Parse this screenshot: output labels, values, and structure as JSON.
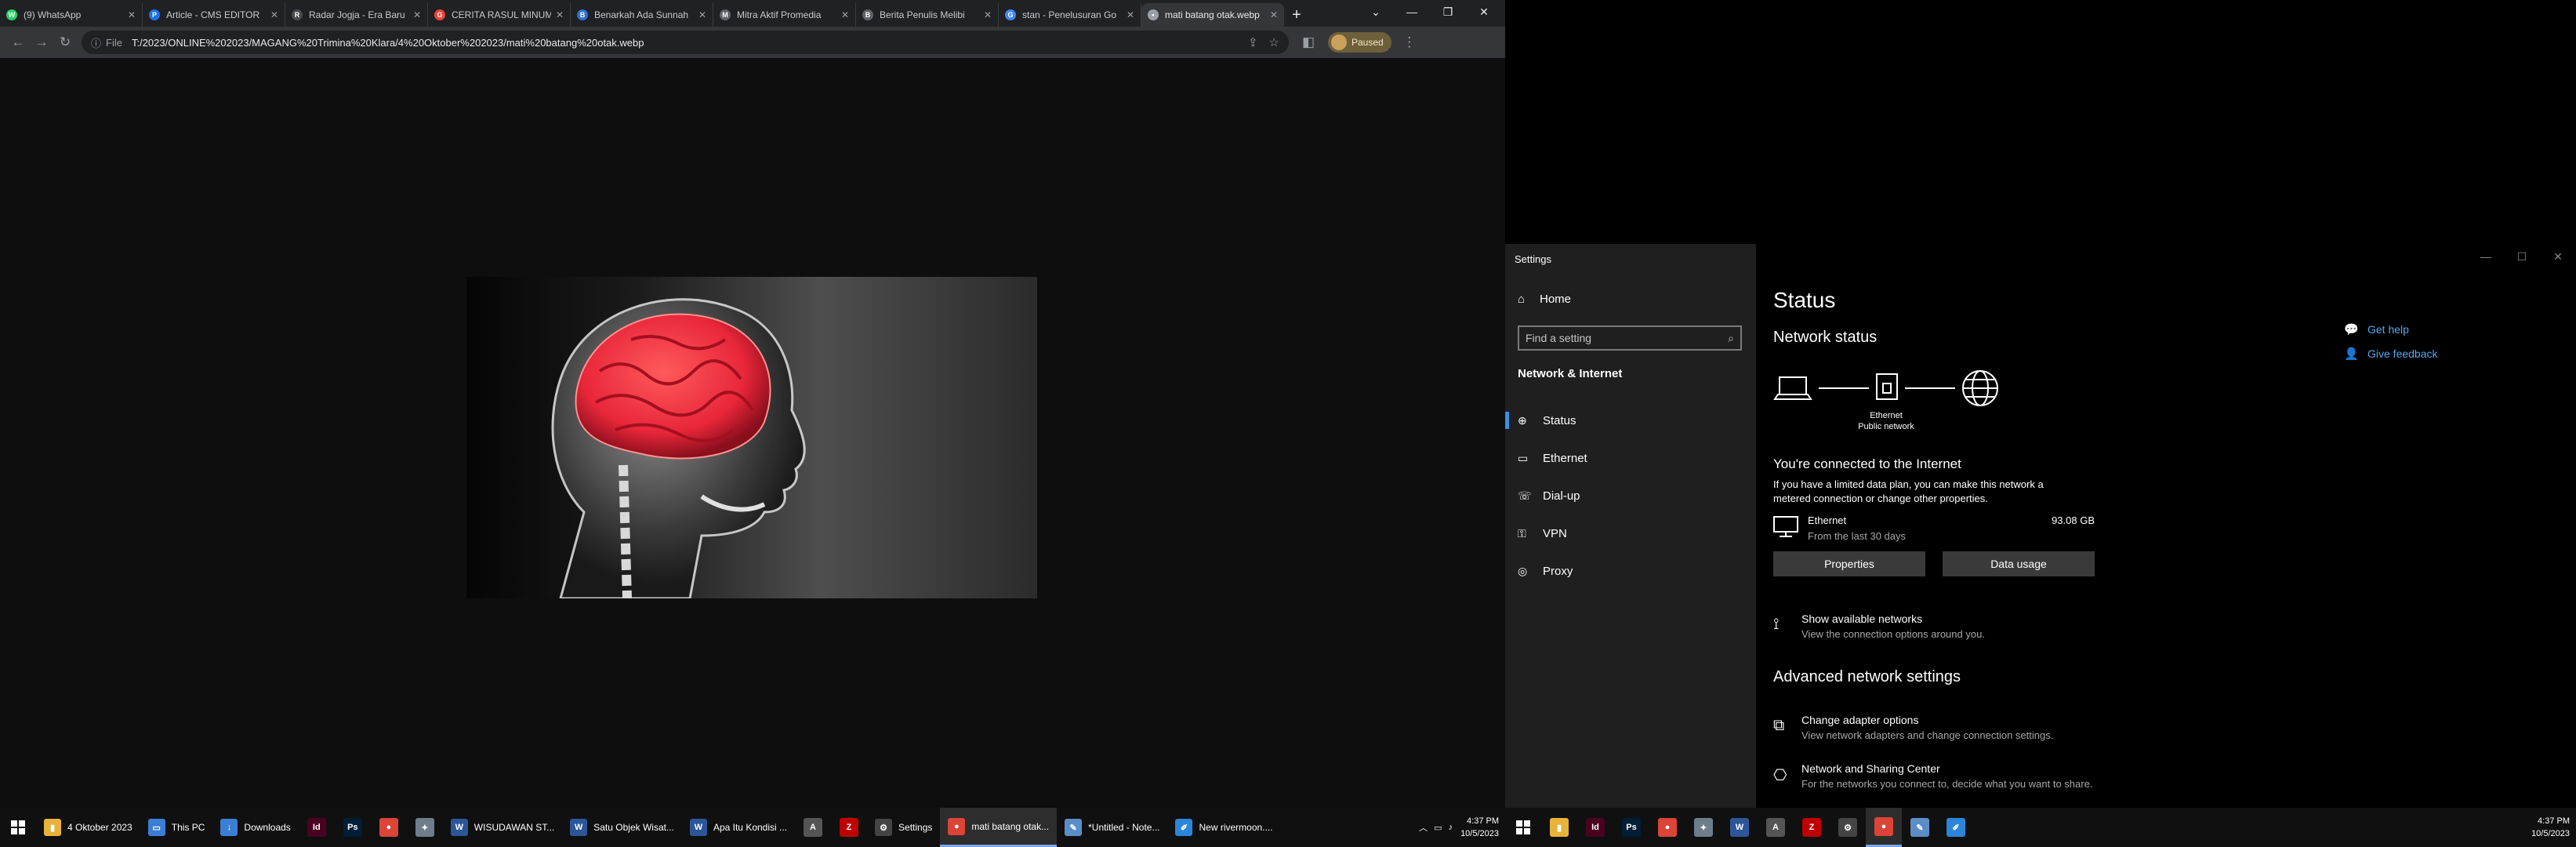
{
  "browser": {
    "tabs": [
      {
        "title": "(9) WhatsApp",
        "fav": "W",
        "color": "#25d366"
      },
      {
        "title": "Article - CMS EDITOR",
        "fav": "P",
        "color": "#1a73e8"
      },
      {
        "title": "Radar Jogja - Era Baru",
        "fav": "R",
        "color": "#4a4a4a"
      },
      {
        "title": "CERITA RASUL MINUM",
        "fav": "G",
        "color": "#ea4335"
      },
      {
        "title": "Benarkah Ada Sunnah",
        "fav": "B",
        "color": "#2f6fd6"
      },
      {
        "title": "Mitra Aktif Promedia",
        "fav": "M",
        "color": "#5f6368"
      },
      {
        "title": "Berita Penulis Melibi",
        "fav": "B",
        "color": "#5f6368"
      },
      {
        "title": "stan - Penelusuran Go",
        "fav": "G",
        "color": "#4285f4"
      },
      {
        "title": "mati batang otak.webp",
        "fav": "•",
        "color": "#9aa0a6"
      }
    ],
    "omnibox": {
      "scheme": "File",
      "url": "T:/2023/ONLINE%202023/MAGANG%20Trimina%20Klara/4%20Oktober%202023/mati%20batang%20otak.webp"
    },
    "profile_label": "Paused"
  },
  "taskbar_left": {
    "items": [
      {
        "label": "4 Oktober 2023",
        "icon": "folder-icon",
        "color": "#e8b33a",
        "glyph": "▮"
      },
      {
        "label": "This PC",
        "icon": "computer-icon",
        "color": "#3b7fd4",
        "glyph": "▭"
      },
      {
        "label": "Downloads",
        "icon": "downloads-icon",
        "color": "#3b7fd4",
        "glyph": "↓"
      },
      {
        "label": "",
        "icon": "indesign-icon",
        "color": "#49021f",
        "glyph": "Id"
      },
      {
        "label": "",
        "icon": "photoshop-icon",
        "color": "#001e36",
        "glyph": "Ps"
      },
      {
        "label": "",
        "icon": "chrome-icon",
        "color": "#db4437",
        "glyph": "●"
      },
      {
        "label": "",
        "icon": "tool-icon",
        "color": "#6d7d8b",
        "glyph": "✦"
      },
      {
        "label": "WISUDAWAN ST...",
        "icon": "word-icon",
        "color": "#2b579a",
        "glyph": "W"
      },
      {
        "label": "Satu Objek Wisat...",
        "icon": "word-icon",
        "color": "#2b579a",
        "glyph": "W"
      },
      {
        "label": "Apa Itu Kondisi ...",
        "icon": "word-icon",
        "color": "#2b579a",
        "glyph": "W"
      },
      {
        "label": "",
        "icon": "pdf-icon",
        "color": "#555555",
        "glyph": "A"
      },
      {
        "label": "",
        "icon": "filezilla-icon",
        "color": "#bf0000",
        "glyph": "Z"
      },
      {
        "label": "Settings",
        "icon": "gear-icon",
        "color": "#444444",
        "glyph": "⚙"
      },
      {
        "label": "mati batang otak...",
        "icon": "chrome-icon",
        "color": "#db4437",
        "glyph": "●",
        "active": true
      },
      {
        "label": "*Untitled - Note...",
        "icon": "notepad-icon",
        "color": "#5b8ec9",
        "glyph": "✎"
      },
      {
        "label": "New rivermoon....",
        "icon": "paint-icon",
        "color": "#2b86d9",
        "glyph": "✐"
      }
    ],
    "clock_time": "4:37 PM",
    "clock_date": "10/5/2023"
  },
  "taskbar_right": {
    "icons": [
      {
        "icon": "explorer-icon",
        "color": "#e8b33a",
        "glyph": "▮"
      },
      {
        "icon": "indesign-icon",
        "color": "#49021f",
        "glyph": "Id"
      },
      {
        "icon": "photoshop-icon",
        "color": "#001e36",
        "glyph": "Ps"
      },
      {
        "icon": "chrome-icon",
        "color": "#db4437",
        "glyph": "●"
      },
      {
        "icon": "tool-icon",
        "color": "#6d7d8b",
        "glyph": "✦"
      },
      {
        "icon": "word-icon",
        "color": "#2b579a",
        "glyph": "W"
      },
      {
        "icon": "pdf-icon",
        "color": "#555555",
        "glyph": "A"
      },
      {
        "icon": "filezilla-icon",
        "color": "#bf0000",
        "glyph": "Z"
      },
      {
        "icon": "gear-icon",
        "color": "#444444",
        "glyph": "⚙"
      },
      {
        "icon": "chrome-icon",
        "color": "#db4437",
        "glyph": "●",
        "active": true
      },
      {
        "icon": "notepad-icon",
        "color": "#5b8ec9",
        "glyph": "✎"
      },
      {
        "icon": "paint-icon",
        "color": "#2b86d9",
        "glyph": "✐"
      }
    ],
    "clock_time": "4:37 PM",
    "clock_date": "10/5/2023"
  },
  "settings": {
    "window_title": "Settings",
    "nav": {
      "home": "Home",
      "search_placeholder": "Find a setting",
      "section": "Network & Internet",
      "items": [
        "Status",
        "Ethernet",
        "Dial-up",
        "VPN",
        "Proxy"
      ]
    },
    "page_title": "Status",
    "network_status_heading": "Network status",
    "diagram_label_1": "Ethernet",
    "diagram_label_2": "Public network",
    "connected_heading": "You're connected to the Internet",
    "connected_desc_1": "If you have a limited data plan, you can make this network a",
    "connected_desc_2": "metered connection or change other properties.",
    "ethernet": {
      "name": "Ethernet",
      "desc": "From the last 30 days",
      "size": "93.08 GB"
    },
    "buttons": {
      "properties": "Properties",
      "data_usage": "Data usage"
    },
    "show_networks": {
      "title": "Show available networks",
      "desc": "View the connection options around you."
    },
    "advanced_heading": "Advanced network settings",
    "adapter": {
      "title": "Change adapter options",
      "desc": "View network adapters and change connection settings."
    },
    "sharing": {
      "title": "Network and Sharing Center",
      "desc": "For the networks you connect to, decide what you want to share."
    },
    "help": {
      "get_help": "Get help",
      "feedback": "Give feedback"
    }
  },
  "colors": {
    "accent": "#3a8ee6",
    "link": "#58a6f0",
    "brain": "#e8263a"
  }
}
